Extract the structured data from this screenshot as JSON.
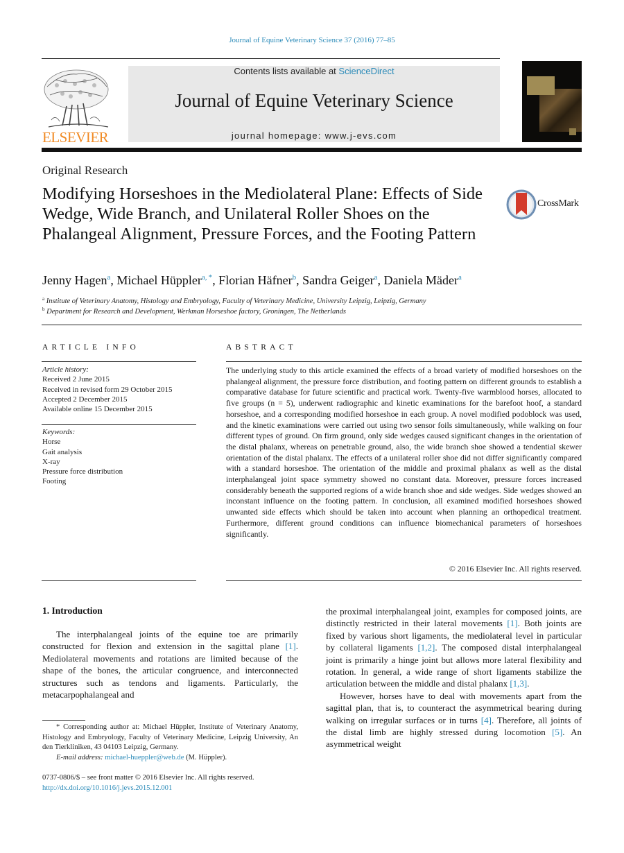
{
  "running_head": "Journal of Equine Veterinary Science 37 (2016) 77–85",
  "masthead": {
    "publisher_wordmark": "ELSEVIER",
    "contents_prefix": "Contents lists available at ",
    "contents_link": "ScienceDirect",
    "journal_title": "Journal of Equine Veterinary Science",
    "homepage_prefix": "journal homepage: ",
    "homepage_url": "www.j-evs.com"
  },
  "colors": {
    "link": "#2a8ab8",
    "elsevier_orange": "#f08a24",
    "banner_bg": "#e8e8e8"
  },
  "article": {
    "section_type": "Original Research",
    "title": "Modifying Horseshoes in the Mediolateral Plane: Effects of Side Wedge, Wide Branch, and Unilateral Roller Shoes on the Phalangeal Alignment, Pressure Forces, and the Footing Pattern",
    "crossmark_label": "CrossMark",
    "authors": [
      {
        "name": "Jenny Hagen",
        "aff": "a"
      },
      {
        "name": "Michael Hüppler",
        "aff": "a, *"
      },
      {
        "name": "Florian Häfner",
        "aff": "b"
      },
      {
        "name": "Sandra Geiger",
        "aff": "a"
      },
      {
        "name": "Daniela Mäder",
        "aff": "a"
      }
    ],
    "affiliations": [
      {
        "key": "a",
        "text": "Institute of Veterinary Anatomy, Histology and Embryology, Faculty of Veterinary Medicine, University Leipzig, Leipzig, Germany"
      },
      {
        "key": "b",
        "text": "Department for Research and Development, Werkman Horseshoe factory, Groningen, The Netherlands"
      }
    ]
  },
  "article_info": {
    "heading": "ARTICLE INFO",
    "history_label": "Article history:",
    "history": [
      "Received 2 June 2015",
      "Received in revised form 29 October 2015",
      "Accepted 2 December 2015",
      "Available online 15 December 2015"
    ],
    "keywords_label": "Keywords:",
    "keywords": [
      "Horse",
      "Gait analysis",
      "X-ray",
      "Pressure force distribution",
      "Footing"
    ]
  },
  "abstract": {
    "heading": "ABSTRACT",
    "text": "The underlying study to this article examined the effects of a broad variety of modified horseshoes on the phalangeal alignment, the pressure force distribution, and footing pattern on different grounds to establish a comparative database for future scientific and practical work. Twenty-five warmblood horses, allocated to five groups (n = 5), underwent radiographic and kinetic examinations for the barefoot hoof, a standard horseshoe, and a corresponding modified horseshoe in each group. A novel modified podoblock was used, and the kinetic examinations were carried out using two sensor foils simultaneously, while walking on four different types of ground. On firm ground, only side wedges caused sig­nificant changes in the orientation of the distal phalanx, whereas on penetrable ground, also, the wide branch shoe showed a tendential skewer orientation of the distal phalanx. The effects of a unilateral roller shoe did not differ significantly compared with a standard horseshoe. The orientation of the middle and proximal phalanx as well as the distal interphalangeal joint space symmetry showed no constant data. Moreover, pressure forces increased considerably beneath the supported regions of a wide branch shoe and side wedges. Side wedges showed an inconstant influence on the footing pattern. In conclusion, all examined modified horseshoes showed unwanted side effects which should be taken into account when planning an orthopedical treatment. Furthermore, different ground conditions can influence biomechanical parameters of horseshoes significantly.",
    "copyright": "© 2016 Elsevier Inc. All rights reserved."
  },
  "introduction": {
    "heading": "1.  Introduction",
    "col1": [
      {
        "t": "The interphalangeal joints of the equine toe are pri­marily constructed for flexion and extension in the sagittal plane "
      },
      {
        "ref": "[1]"
      },
      {
        "t": ". Mediolateral movements and rotations are limited because of the shape of the bones, the articular congruence, and interconnected structures such as tendons and ligaments. Particularly, the metacarpophalangeal and"
      }
    ],
    "col2_p1": [
      {
        "t": "the proximal interphalangeal joint, examples for composed joints, are distinctly restricted in their lateral movements "
      },
      {
        "ref": "[1]"
      },
      {
        "t": ". Both joints are fixed by various short ligaments, the mediolateral level in particular by collateral ligaments "
      },
      {
        "ref": "[1,2]"
      },
      {
        "t": ". The composed distal interphalangeal joint is primarily a hinge joint but allows more lateral flexibility and rotation. In general, a wide range of short ligaments stabilize the articulation between the middle and distal phalanx "
      },
      {
        "ref": "[1,3]"
      },
      {
        "t": "."
      }
    ],
    "col2_p2": [
      {
        "t": "However, horses have to deal with movements apart from the sagittal plan, that is, to counteract the asymmet­rical bearing during walking on irregular surfaces or in turns "
      },
      {
        "ref": "[4]"
      },
      {
        "t": ". Therefore, all joints of the distal limb are highly stressed during locomotion "
      },
      {
        "ref": "[5]"
      },
      {
        "t": ". An asymmetrical weight"
      }
    ]
  },
  "footnote": {
    "corresponding": "* Corresponding author at: Michael Hüppler, Institute of Veterinary Anatomy, Histology and Embryology, Faculty of Veterinary Medicine, Leipzig University, An den Tierkliniken, 43 04103 Leipzig, Germany.",
    "email_label": "E-mail address:",
    "email": "michael-hueppler@web.de",
    "email_suffix": " (M. Hüppler).",
    "issn_line": "0737-0806/$ – see front matter © 2016 Elsevier Inc. All rights reserved.",
    "doi": "http://dx.doi.org/10.1016/j.jevs.2015.12.001"
  }
}
